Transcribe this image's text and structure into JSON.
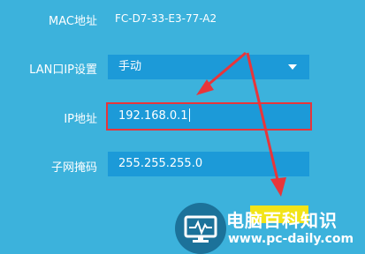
{
  "form": {
    "mac": {
      "label": "MAC地址",
      "value": "FC-D7-33-E3-77-A2"
    },
    "lan_ip_mode": {
      "label": "LAN口IP设置",
      "value": "手动"
    },
    "ip": {
      "label": "IP地址",
      "value": "192.168.0.1"
    },
    "subnet": {
      "label": "子网掩码",
      "value": "255.255.255.0"
    }
  },
  "watermark": {
    "title": "电脑百科知识",
    "url": "www.pc-daily.com",
    "icon": "monitor-pulse-icon"
  },
  "colors": {
    "background": "#3cb2dc",
    "field": "#1c9ad8",
    "highlight": "#e8353a",
    "save_button": "#f2e418"
  }
}
